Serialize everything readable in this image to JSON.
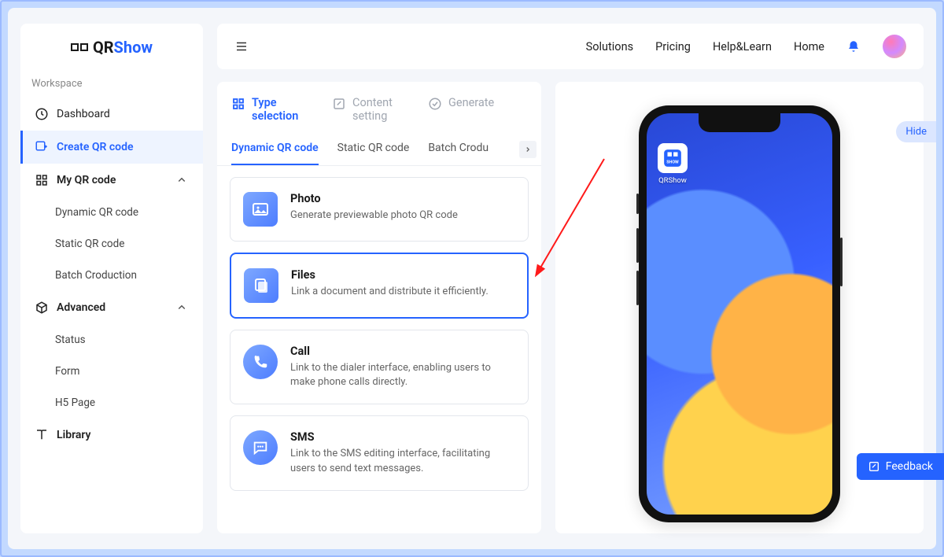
{
  "brand": {
    "prefix": "QR",
    "suffix": "Show"
  },
  "sidebar": {
    "workspace_label": "Workspace",
    "dashboard": "Dashboard",
    "create": "Create QR code",
    "myqr": {
      "label": "My QR code",
      "items": [
        "Dynamic QR code",
        "Static QR code",
        "Batch Croduction"
      ]
    },
    "advanced": {
      "label": "Advanced",
      "items": [
        "Status",
        "Form",
        "H5 Page"
      ]
    },
    "library": "Library"
  },
  "nav": [
    "Solutions",
    "Pricing",
    "Help&Learn",
    "Home"
  ],
  "steps": [
    {
      "label": "Type selection"
    },
    {
      "label": "Content setting"
    },
    {
      "label": "Generate"
    }
  ],
  "tabs": [
    "Dynamic QR code",
    "Static QR code",
    "Batch Crodu"
  ],
  "types": [
    {
      "title": "Photo",
      "desc": "Generate previewable photo QR code"
    },
    {
      "title": "Files",
      "desc": "Link a document and distribute it efficiently."
    },
    {
      "title": "Call",
      "desc": "Link to the dialer interface, enabling users to make phone calls directly."
    },
    {
      "title": "SMS",
      "desc": "Link to the SMS editing interface, facilitating users to send text messages."
    }
  ],
  "preview": {
    "hide": "Hide",
    "app_label": "QRShow",
    "app_badge": "SHOW"
  },
  "feedback": "Feedback"
}
